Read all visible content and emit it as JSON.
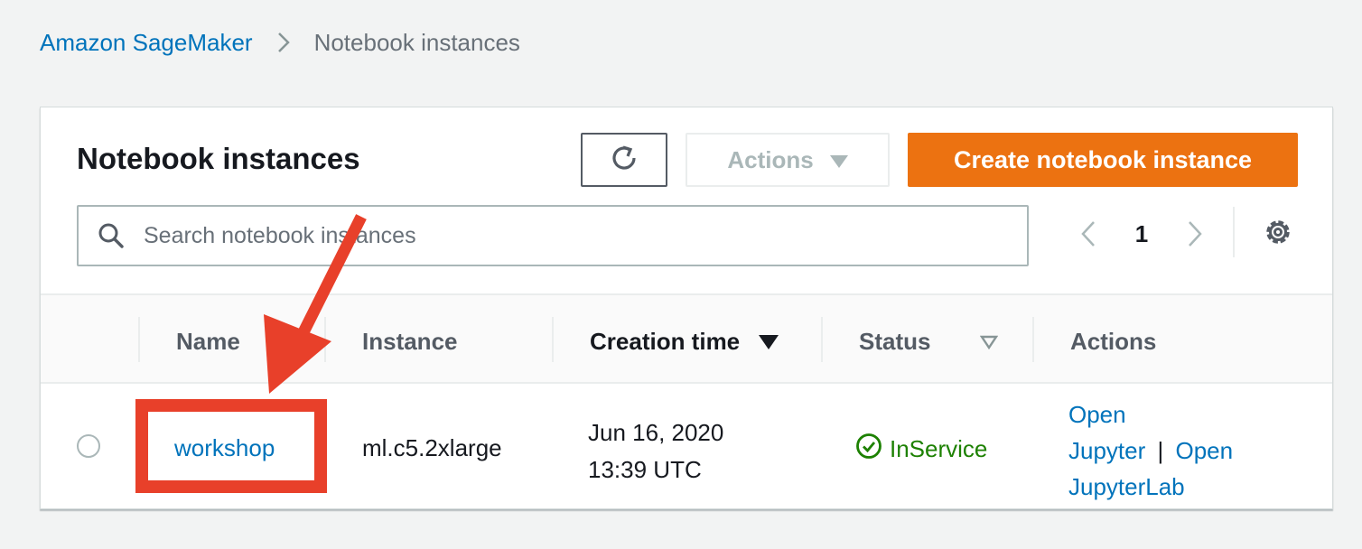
{
  "breadcrumb": {
    "root": "Amazon SageMaker",
    "current": "Notebook instances"
  },
  "panel": {
    "title": "Notebook instances",
    "actions_label": "Actions",
    "create_label": "Create notebook instance"
  },
  "search": {
    "placeholder": "Search notebook instances",
    "value": ""
  },
  "pagination": {
    "current_page": "1"
  },
  "table": {
    "columns": [
      "Name",
      "Instance",
      "Creation time",
      "Status",
      "Actions"
    ],
    "sort_column": "Creation time",
    "rows": [
      {
        "name": "workshop",
        "instance": "ml.c5.2xlarge",
        "creation_date": "Jun 16, 2020",
        "creation_time": "13:39 UTC",
        "status": "InService",
        "action_open": "Open",
        "action_jupyter": "Jupyter",
        "action_sep": "|",
        "action_open2": "Open",
        "action_jupyterlab": "JupyterLab"
      }
    ]
  },
  "icons": {
    "refresh": "refresh-icon",
    "dropdown": "caret-down-icon",
    "search": "search-icon",
    "prev": "chevron-left-icon",
    "next": "chevron-right-icon",
    "settings": "gear-icon",
    "sort": "sort-descending-icon",
    "filter": "sort-unsorted-icon",
    "status": "check-circle-icon"
  },
  "colors": {
    "link": "#0073bb",
    "primary_button": "#ec7211",
    "success": "#1d8102",
    "annotation": "#e8402a"
  }
}
